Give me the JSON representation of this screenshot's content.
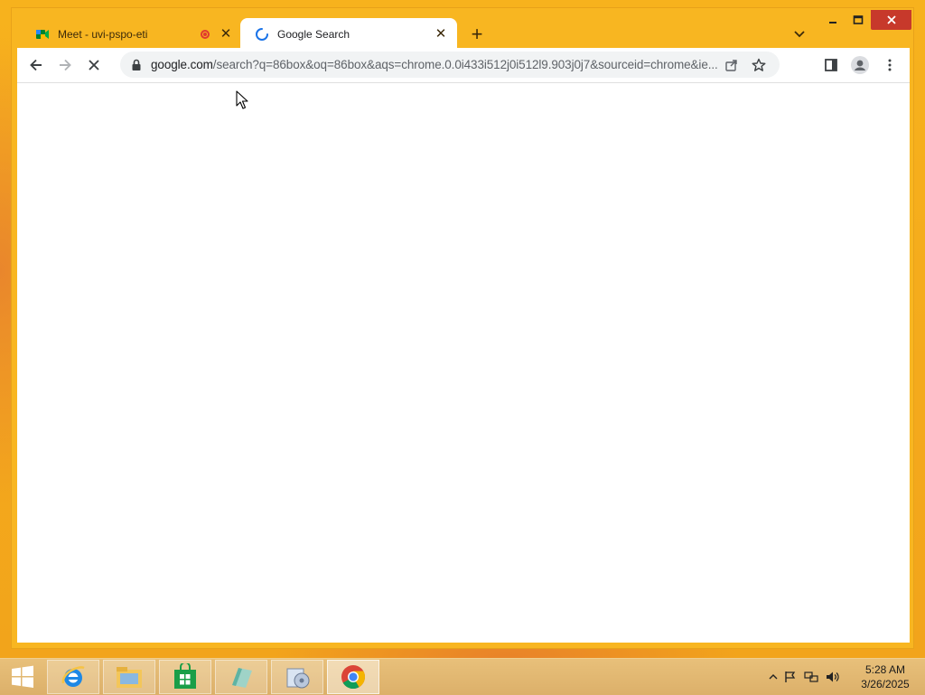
{
  "tabs": [
    {
      "title": "Meet - uvi-pspo-eti",
      "active": false,
      "recording": true,
      "favicon": "google-meet-icon"
    },
    {
      "title": "Google Search",
      "active": true,
      "loading": true,
      "favicon": "loading-spinner-icon"
    }
  ],
  "omnibox": {
    "host": "google.com",
    "path": "/search?q=86box&oq=86box&aqs=chrome.0.0i433i512j0i512l9.903j0j7&sourceid=chrome&ie..."
  },
  "clock": {
    "time": "5:28 AM",
    "date": "3/26/2025"
  },
  "taskbar": {
    "items": [
      "start-button",
      "internet-explorer-icon",
      "file-explorer-icon",
      "windows-store-icon",
      "app-icon",
      "media-icon",
      "chrome-icon"
    ]
  },
  "colors": {
    "accent": "#f8b621",
    "close_red": "#c7392b",
    "rec_red": "#e03a2f"
  }
}
